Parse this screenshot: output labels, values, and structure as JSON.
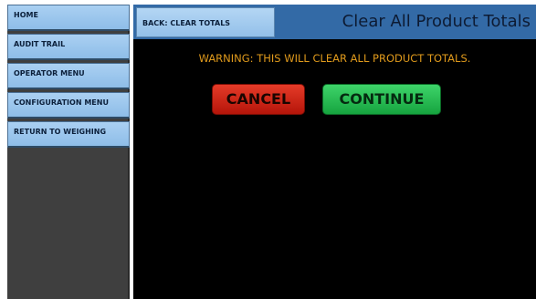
{
  "sidebar": {
    "items": [
      {
        "label": "HOME"
      },
      {
        "label": "AUDIT TRAIL"
      },
      {
        "label": "OPERATOR MENU"
      },
      {
        "label": "CONFIGURATION MENU"
      },
      {
        "label": "RETURN TO WEIGHING"
      }
    ]
  },
  "header": {
    "back_label": "BACK: CLEAR TOTALS",
    "title": "Clear All Product Totals"
  },
  "main": {
    "warning": "WARNING: THIS WILL CLEAR ALL PRODUCT TOTALS.",
    "cancel_label": "CANCEL",
    "continue_label": "CONTINUE"
  },
  "colors": {
    "nav_button": "#9cc8ef",
    "header_bar": "#336aa6",
    "warning_text": "#e09a1c",
    "cancel": "#d42a1a",
    "continue": "#27bf55",
    "background": "#000000"
  }
}
